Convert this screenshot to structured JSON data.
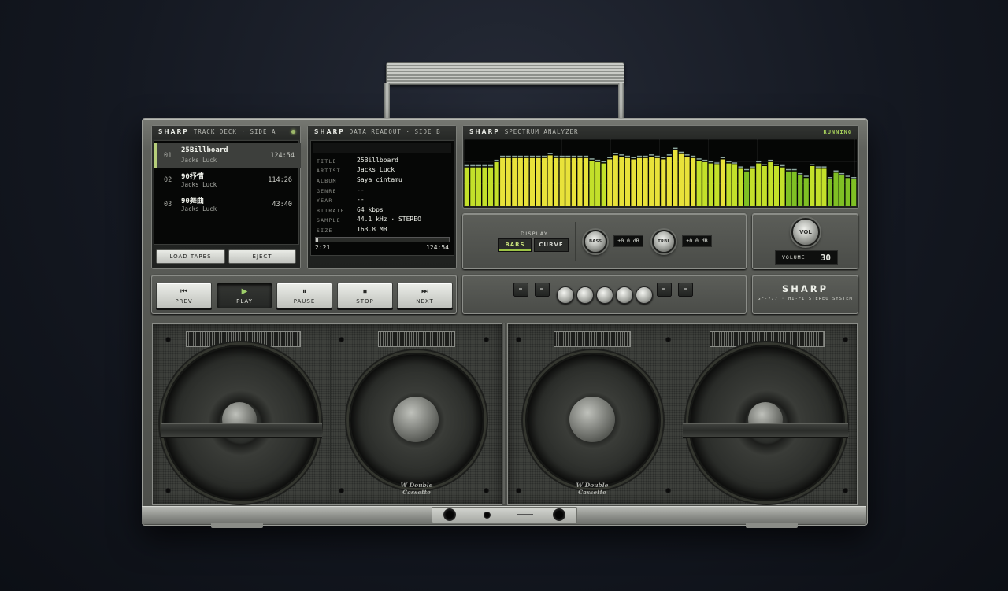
{
  "track_deck": {
    "brand": "SHARP",
    "title": "TRACK DECK · SIDE A",
    "tracks": [
      {
        "num": "01",
        "title": "25Billboard",
        "artist": "Jacks Luck",
        "duration": "124:54"
      },
      {
        "num": "02",
        "title": "90抒情",
        "artist": "Jacks Luck",
        "duration": "114:26"
      },
      {
        "num": "03",
        "title": "90舞曲",
        "artist": "Jacks Luck",
        "duration": "43:40"
      }
    ],
    "load_label": "LOAD TAPES",
    "eject_label": "EJECT"
  },
  "readout": {
    "brand": "SHARP",
    "title": "DATA READOUT · SIDE B",
    "fields": [
      {
        "label": "TITLE",
        "value": "25Billboard"
      },
      {
        "label": "ARTIST",
        "value": "Jacks Luck"
      },
      {
        "label": "ALBUM",
        "value": "Saya cintamu"
      },
      {
        "label": "GENRE",
        "value": "--"
      },
      {
        "label": "YEAR",
        "value": "--"
      },
      {
        "label": "BITRATE",
        "value": "64 kbps"
      },
      {
        "label": "SAMPLE",
        "value": "44.1 kHz · STEREO"
      },
      {
        "label": "SIZE",
        "value": "163.8 MB"
      }
    ],
    "elapsed": "2:21",
    "total": "124:54",
    "progress": 0.018
  },
  "spectrum": {
    "brand": "SHARP",
    "title": "SPECTRUM ANALYZER",
    "status": "RUNNING",
    "levels": [
      0.58,
      0.58,
      0.58,
      0.58,
      0.58,
      0.66,
      0.72,
      0.72,
      0.72,
      0.72,
      0.72,
      0.72,
      0.72,
      0.72,
      0.76,
      0.72,
      0.72,
      0.72,
      0.72,
      0.72,
      0.72,
      0.68,
      0.66,
      0.64,
      0.7,
      0.76,
      0.74,
      0.72,
      0.7,
      0.72,
      0.72,
      0.74,
      0.72,
      0.7,
      0.74,
      0.84,
      0.78,
      0.74,
      0.72,
      0.68,
      0.66,
      0.64,
      0.62,
      0.7,
      0.64,
      0.62,
      0.56,
      0.52,
      0.56,
      0.64,
      0.6,
      0.66,
      0.6,
      0.58,
      0.52,
      0.52,
      0.46,
      0.42,
      0.6,
      0.56,
      0.56,
      0.4,
      0.5,
      0.46,
      0.42,
      0.4
    ],
    "colors": {
      "high": "#e8e23a",
      "mid": "#c3e02a",
      "low": "#7fc024"
    }
  },
  "eq": {
    "display_label": "DISPLAY",
    "modes": [
      "BARS",
      "CURVE"
    ],
    "active_mode": "BARS",
    "bass_label": "BASS",
    "bass_value": "+0.0 dB",
    "treble_label": "TRBL",
    "treble_value": "+0.0 dB"
  },
  "volume": {
    "knob_label": "VOL",
    "label": "VOLUME",
    "value": "30"
  },
  "transport": [
    {
      "icon": "prev-icon",
      "glyph": "⏮",
      "label": "PREV"
    },
    {
      "icon": "play-icon",
      "glyph": "▶",
      "label": "PLAY"
    },
    {
      "icon": "pause-icon",
      "glyph": "⏸",
      "label": "PAUSE"
    },
    {
      "icon": "stop-icon",
      "glyph": "⏹",
      "label": "STOP"
    },
    {
      "icon": "next-icon",
      "glyph": "⏭",
      "label": "NEXT"
    }
  ],
  "badge": {
    "brand": "SHARP",
    "model": "GF-777 · HI-FI STEREO SYSTEM"
  },
  "speaker_logo": {
    "line1": "W Double",
    "line2": "Cassette"
  }
}
